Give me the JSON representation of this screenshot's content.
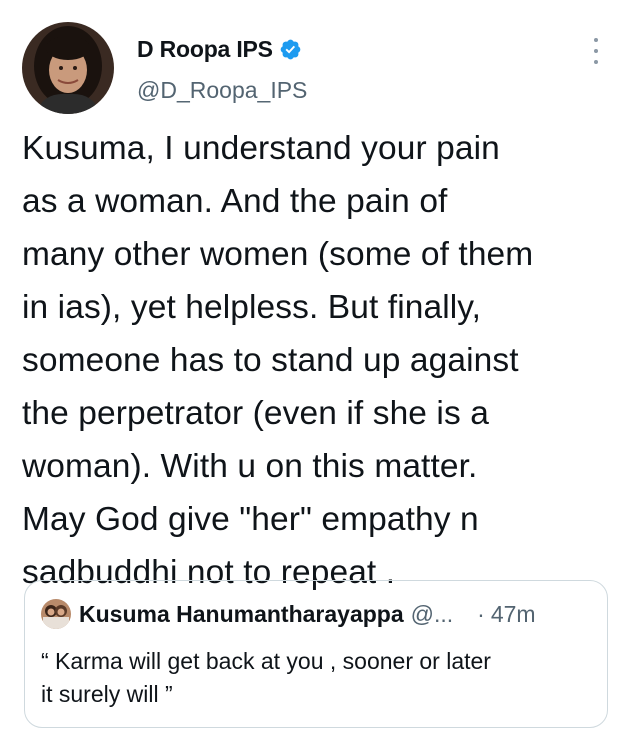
{
  "author": {
    "display_name": "D Roopa IPS",
    "handle": "@D_Roopa_IPS",
    "verified": true,
    "avatar_icon": "profile-photo-icon"
  },
  "tweet": {
    "text": "Kusuma, I understand your pain\nas a woman. And the pain of\nmany other women (some of them\nin ias), yet helpless. But finally,\nsomeone has to stand up against\nthe perpetrator (even if she is a\nwoman). With u on this matter.\nMay God give \"her\"  empathy n\nsadbuddhi not to repeat ."
  },
  "quoted_tweet": {
    "display_name": "Kusuma Hanumantharayappa",
    "handle": "@...",
    "separator": "·",
    "time": "47m",
    "text": "“ Karma will get back at you , sooner or later\nit surely will ”"
  },
  "colors": {
    "text": "#0f1419",
    "secondary": "#536471",
    "verified_blue": "#1d9bf0",
    "border": "#cfd9de"
  }
}
